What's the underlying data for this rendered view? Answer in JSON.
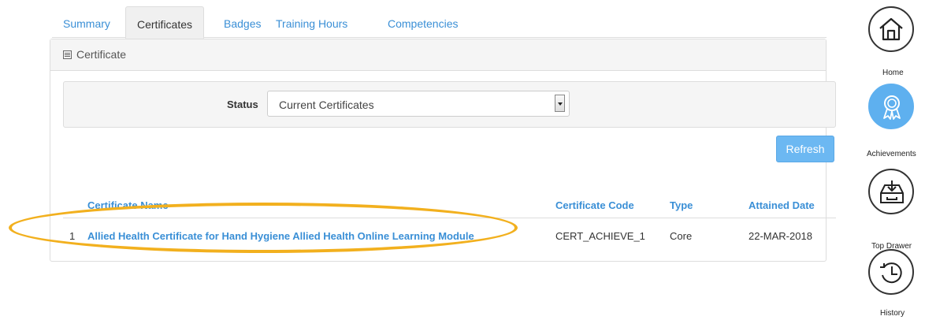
{
  "tabs": [
    {
      "label": "Summary"
    },
    {
      "label": "Certificates"
    },
    {
      "label": "Badges"
    },
    {
      "label": "Training Hours"
    },
    {
      "label": "Competencies"
    }
  ],
  "panel": {
    "title": "Certificate",
    "icon": "document-icon"
  },
  "filter": {
    "status_label": "Status",
    "status_value": "Current Certificates"
  },
  "refresh_label": "Refresh",
  "table": {
    "headers": [
      "Certificate Name",
      "Certificate Code",
      "Type",
      "Attained Date"
    ],
    "rows": [
      {
        "index": "1",
        "name": "Allied Health Certificate for Hand Hygiene Allied Health Online Learning Module",
        "code": "CERT_ACHIEVE_1",
        "type": "Core",
        "date": "22-MAR-2018"
      }
    ]
  },
  "sidebar": {
    "items": [
      {
        "label": "Home",
        "icon": "home-icon"
      },
      {
        "label": "Achievements",
        "icon": "award-ribbon-icon"
      },
      {
        "label": "Top Drawer",
        "icon": "drawer-download-icon"
      },
      {
        "label": "History",
        "icon": "history-clock-icon"
      }
    ]
  },
  "colors": {
    "link": "#3a8fd6",
    "refresh_button": "#6cb8f2",
    "highlight_ellipse": "#f2b01e",
    "active_sidebar": "#5eb0ef"
  }
}
